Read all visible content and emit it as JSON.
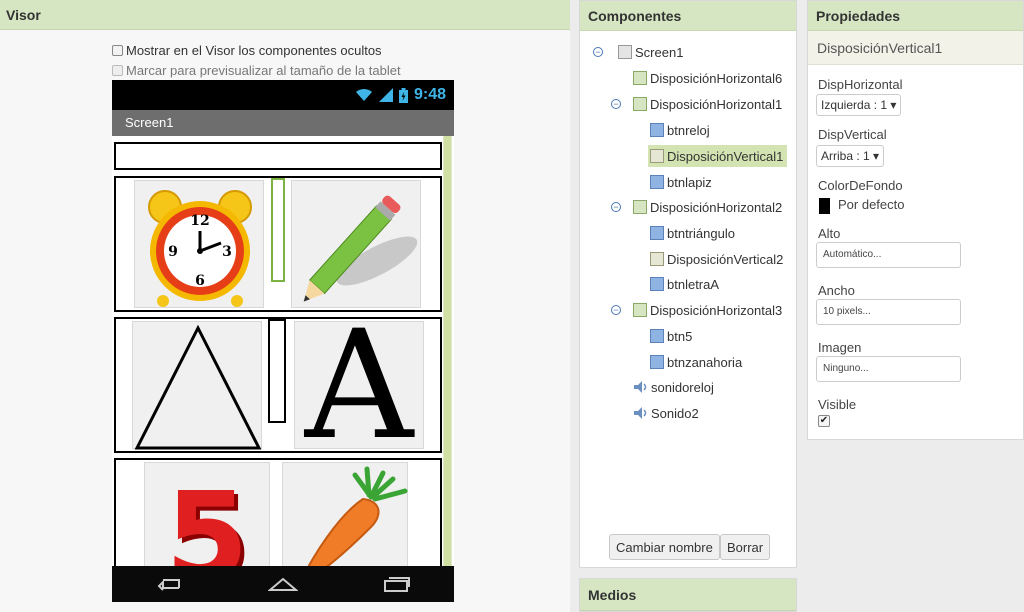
{
  "visor": {
    "title": "Visor",
    "show_hidden_label": "Mostrar en el Visor los componentes ocultos",
    "tablet_preview_label": "Marcar para previsualizar al tamaño de la tablet"
  },
  "phone": {
    "time": "9:48",
    "screen_title": "Screen1",
    "clock_numbers": [
      "12",
      "3",
      "6",
      "9"
    ],
    "number_five": "5",
    "letter_a": "A"
  },
  "components": {
    "title": "Componentes",
    "tree": [
      {
        "label": "Screen1",
        "icon": "screen-icon"
      },
      {
        "label": "DisposiciónHorizontal6",
        "icon": "horizontal-arrangement-icon"
      },
      {
        "label": "DisposiciónHorizontal1",
        "icon": "horizontal-arrangement-icon"
      },
      {
        "label": "btnreloj",
        "icon": "button-icon"
      },
      {
        "label": "DisposiciónVertical1",
        "icon": "vertical-arrangement-icon"
      },
      {
        "label": "btnlapiz",
        "icon": "button-icon"
      },
      {
        "label": "DisposiciónHorizontal2",
        "icon": "horizontal-arrangement-icon"
      },
      {
        "label": "btntriángulo",
        "icon": "button-icon"
      },
      {
        "label": "DisposiciónVertical2",
        "icon": "vertical-arrangement-icon"
      },
      {
        "label": "btnletraA",
        "icon": "button-icon"
      },
      {
        "label": "DisposiciónHorizontal3",
        "icon": "horizontal-arrangement-icon"
      },
      {
        "label": "btn5",
        "icon": "button-icon"
      },
      {
        "label": "btnzanahoria",
        "icon": "button-icon"
      },
      {
        "label": "sonidoreloj",
        "icon": "sound-icon"
      },
      {
        "label": "Sonido2",
        "icon": "sound-icon"
      }
    ],
    "rename_button": "Cambiar nombre",
    "delete_button": "Borrar"
  },
  "media": {
    "title": "Medios"
  },
  "properties": {
    "title": "Propiedades",
    "component_name": "DisposiciónVertical1",
    "align_horizontal_label": "DispHorizontal",
    "align_horizontal_value": "Izquierda : 1 ▾",
    "align_vertical_label": "DispVertical",
    "align_vertical_value": "Arriba : 1 ▾",
    "background_color_label": "ColorDeFondo",
    "background_color_value": "Por defecto",
    "height_label": "Alto",
    "height_value": "Automático...",
    "width_label": "Ancho",
    "width_value": "10 pixels...",
    "image_label": "Imagen",
    "image_value": "Ninguno...",
    "visible_label": "Visible",
    "visible_checked": true
  },
  "colors": {
    "header_green": "#d6e6c2",
    "selection_green": "#d3e4b2",
    "status_blue": "#3fb4e6"
  }
}
